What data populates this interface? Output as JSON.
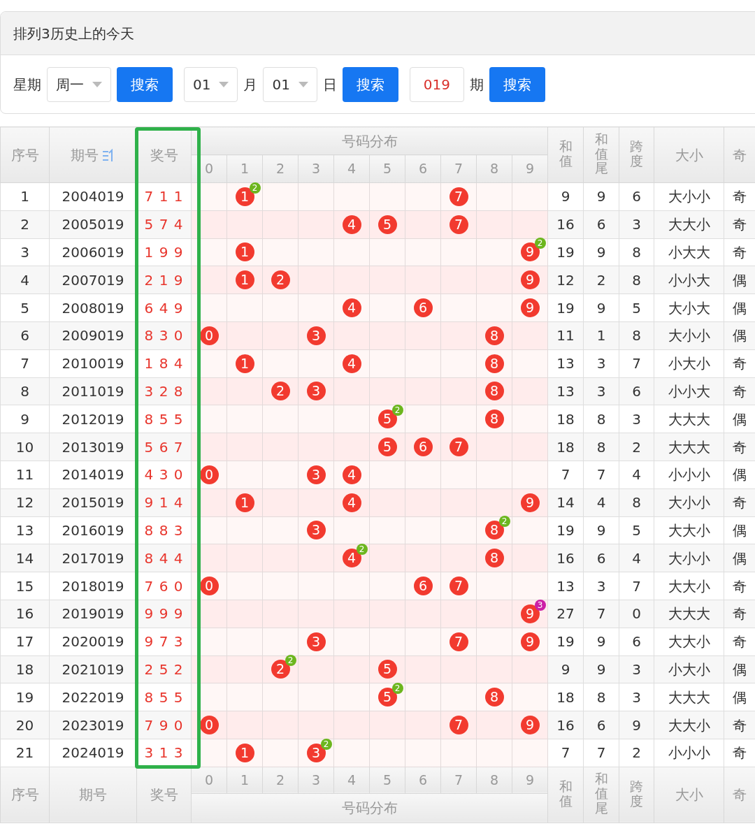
{
  "title": "排列3历史上的今天",
  "filters": [
    {
      "kind": "label",
      "text": "星期"
    },
    {
      "kind": "select",
      "value": "周一"
    },
    {
      "kind": "button",
      "text": "搜索"
    },
    {
      "kind": "select",
      "value": "01"
    },
    {
      "kind": "label",
      "text": "月"
    },
    {
      "kind": "select",
      "value": "01"
    },
    {
      "kind": "label",
      "text": "日"
    },
    {
      "kind": "button",
      "text": "搜索"
    },
    {
      "kind": "input",
      "value": "019"
    },
    {
      "kind": "label",
      "text": "期"
    },
    {
      "kind": "button",
      "text": "搜索"
    }
  ],
  "header": {
    "seq": "序号",
    "period": "期号",
    "sorted": true,
    "prize": "奖号",
    "distribution": "号码分布",
    "digits": [
      "0",
      "1",
      "2",
      "3",
      "4",
      "5",
      "6",
      "7",
      "8",
      "9"
    ],
    "sum": "和值",
    "tail": "和值尾",
    "span": "跨度",
    "size": "大小",
    "parity": "奇"
  },
  "rows": [
    {
      "seq": "1",
      "period": "2004019",
      "prize": "7 1 1",
      "cells": [
        null,
        {
          "ball": "1",
          "repeat": "2",
          "color": "#6cb61e"
        },
        null,
        null,
        null,
        null,
        null,
        {
          "ball": "7"
        },
        null,
        null
      ],
      "sum": "9",
      "tail": "9",
      "span": "6",
      "size": "大小小",
      "parity": "奇"
    },
    {
      "seq": "2",
      "period": "2005019",
      "prize": "5 7 4",
      "cells": [
        null,
        null,
        null,
        null,
        {
          "ball": "4"
        },
        {
          "ball": "5"
        },
        null,
        {
          "ball": "7"
        },
        null,
        null
      ],
      "sum": "16",
      "tail": "6",
      "span": "3",
      "size": "大大小",
      "parity": "奇"
    },
    {
      "seq": "3",
      "period": "2006019",
      "prize": "1 9 9",
      "cells": [
        null,
        {
          "ball": "1"
        },
        null,
        null,
        null,
        null,
        null,
        null,
        null,
        {
          "ball": "9",
          "repeat": "2",
          "color": "#6cb61e"
        }
      ],
      "sum": "19",
      "tail": "9",
      "span": "8",
      "size": "小大大",
      "parity": "奇"
    },
    {
      "seq": "4",
      "period": "2007019",
      "prize": "2 1 9",
      "cells": [
        null,
        {
          "ball": "1"
        },
        {
          "ball": "2"
        },
        null,
        null,
        null,
        null,
        null,
        null,
        {
          "ball": "9"
        }
      ],
      "sum": "12",
      "tail": "2",
      "span": "8",
      "size": "小小大",
      "parity": "偶"
    },
    {
      "seq": "5",
      "period": "2008019",
      "prize": "6 4 9",
      "cells": [
        null,
        null,
        null,
        null,
        {
          "ball": "4"
        },
        null,
        {
          "ball": "6"
        },
        null,
        null,
        {
          "ball": "9"
        }
      ],
      "sum": "19",
      "tail": "9",
      "span": "5",
      "size": "大小大",
      "parity": "偶"
    },
    {
      "seq": "6",
      "period": "2009019",
      "prize": "8 3 0",
      "cells": [
        {
          "ball": "0"
        },
        null,
        null,
        {
          "ball": "3"
        },
        null,
        null,
        null,
        null,
        {
          "ball": "8"
        },
        null
      ],
      "sum": "11",
      "tail": "1",
      "span": "8",
      "size": "大小小",
      "parity": "偶"
    },
    {
      "seq": "7",
      "period": "2010019",
      "prize": "1 8 4",
      "cells": [
        null,
        {
          "ball": "1"
        },
        null,
        null,
        {
          "ball": "4"
        },
        null,
        null,
        null,
        {
          "ball": "8"
        },
        null
      ],
      "sum": "13",
      "tail": "3",
      "span": "7",
      "size": "小大小",
      "parity": "奇"
    },
    {
      "seq": "8",
      "period": "2011019",
      "prize": "3 2 8",
      "cells": [
        null,
        null,
        {
          "ball": "2"
        },
        {
          "ball": "3"
        },
        null,
        null,
        null,
        null,
        {
          "ball": "8"
        },
        null
      ],
      "sum": "13",
      "tail": "3",
      "span": "6",
      "size": "小小大",
      "parity": "奇"
    },
    {
      "seq": "9",
      "period": "2012019",
      "prize": "8 5 5",
      "cells": [
        null,
        null,
        null,
        null,
        null,
        {
          "ball": "5",
          "repeat": "2",
          "color": "#6cb61e"
        },
        null,
        null,
        {
          "ball": "8"
        },
        null
      ],
      "sum": "18",
      "tail": "8",
      "span": "3",
      "size": "大大大",
      "parity": "偶"
    },
    {
      "seq": "10",
      "period": "2013019",
      "prize": "5 6 7",
      "cells": [
        null,
        null,
        null,
        null,
        null,
        {
          "ball": "5"
        },
        {
          "ball": "6"
        },
        {
          "ball": "7"
        },
        null,
        null
      ],
      "sum": "18",
      "tail": "8",
      "span": "2",
      "size": "大大大",
      "parity": "奇"
    },
    {
      "seq": "11",
      "period": "2014019",
      "prize": "4 3 0",
      "cells": [
        {
          "ball": "0"
        },
        null,
        null,
        {
          "ball": "3"
        },
        {
          "ball": "4"
        },
        null,
        null,
        null,
        null,
        null
      ],
      "sum": "7",
      "tail": "7",
      "span": "4",
      "size": "小小小",
      "parity": "偶"
    },
    {
      "seq": "12",
      "period": "2015019",
      "prize": "9 1 4",
      "cells": [
        null,
        {
          "ball": "1"
        },
        null,
        null,
        {
          "ball": "4"
        },
        null,
        null,
        null,
        null,
        {
          "ball": "9"
        }
      ],
      "sum": "14",
      "tail": "4",
      "span": "8",
      "size": "大小小",
      "parity": "奇"
    },
    {
      "seq": "13",
      "period": "2016019",
      "prize": "8 8 3",
      "cells": [
        null,
        null,
        null,
        {
          "ball": "3"
        },
        null,
        null,
        null,
        null,
        {
          "ball": "8",
          "repeat": "2",
          "color": "#6cb61e"
        },
        null
      ],
      "sum": "19",
      "tail": "9",
      "span": "5",
      "size": "大大小",
      "parity": "偶"
    },
    {
      "seq": "14",
      "period": "2017019",
      "prize": "8 4 4",
      "cells": [
        null,
        null,
        null,
        null,
        {
          "ball": "4",
          "repeat": "2",
          "color": "#6cb61e"
        },
        null,
        null,
        null,
        {
          "ball": "8"
        },
        null
      ],
      "sum": "16",
      "tail": "6",
      "span": "4",
      "size": "大小小",
      "parity": "偶"
    },
    {
      "seq": "15",
      "period": "2018019",
      "prize": "7 6 0",
      "cells": [
        {
          "ball": "0"
        },
        null,
        null,
        null,
        null,
        null,
        {
          "ball": "6"
        },
        {
          "ball": "7"
        },
        null,
        null
      ],
      "sum": "13",
      "tail": "3",
      "span": "7",
      "size": "大大小",
      "parity": "奇"
    },
    {
      "seq": "16",
      "period": "2019019",
      "prize": "9 9 9",
      "cells": [
        null,
        null,
        null,
        null,
        null,
        null,
        null,
        null,
        null,
        {
          "ball": "9",
          "repeat": "3",
          "color": "#cc1fa6"
        }
      ],
      "sum": "27",
      "tail": "7",
      "span": "0",
      "size": "大大大",
      "parity": "奇"
    },
    {
      "seq": "17",
      "period": "2020019",
      "prize": "9 7 3",
      "cells": [
        null,
        null,
        null,
        {
          "ball": "3"
        },
        null,
        null,
        null,
        {
          "ball": "7"
        },
        null,
        {
          "ball": "9"
        }
      ],
      "sum": "19",
      "tail": "9",
      "span": "6",
      "size": "大大小",
      "parity": "奇"
    },
    {
      "seq": "18",
      "period": "2021019",
      "prize": "2 5 2",
      "cells": [
        null,
        null,
        {
          "ball": "2",
          "repeat": "2",
          "color": "#6cb61e"
        },
        null,
        null,
        {
          "ball": "5"
        },
        null,
        null,
        null,
        null
      ],
      "sum": "9",
      "tail": "9",
      "span": "3",
      "size": "小大小",
      "parity": "偶"
    },
    {
      "seq": "19",
      "period": "2022019",
      "prize": "8 5 5",
      "cells": [
        null,
        null,
        null,
        null,
        null,
        {
          "ball": "5",
          "repeat": "2",
          "color": "#6cb61e"
        },
        null,
        null,
        {
          "ball": "8"
        },
        null
      ],
      "sum": "18",
      "tail": "8",
      "span": "3",
      "size": "大大大",
      "parity": "偶"
    },
    {
      "seq": "20",
      "period": "2023019",
      "prize": "7 9 0",
      "cells": [
        {
          "ball": "0"
        },
        null,
        null,
        null,
        null,
        null,
        null,
        {
          "ball": "7"
        },
        null,
        {
          "ball": "9"
        }
      ],
      "sum": "16",
      "tail": "6",
      "span": "9",
      "size": "大大小",
      "parity": "奇"
    },
    {
      "seq": "21",
      "period": "2024019",
      "prize": "3 1 3",
      "cells": [
        null,
        {
          "ball": "1"
        },
        null,
        {
          "ball": "3",
          "repeat": "2",
          "color": "#6cb61e"
        },
        null,
        null,
        null,
        null,
        null,
        null
      ],
      "sum": "7",
      "tail": "7",
      "span": "2",
      "size": "小小小",
      "parity": "奇"
    }
  ],
  "footer": {
    "seq": "序号",
    "period": "期号",
    "sorted": false,
    "prize": "奖号",
    "distribution": "号码分布",
    "digits": [
      "0",
      "1",
      "2",
      "3",
      "4",
      "5",
      "6",
      "7",
      "8",
      "9"
    ],
    "sum": "和值",
    "tail": "和值尾",
    "span": "跨度",
    "size": "大小",
    "parity": "奇"
  }
}
